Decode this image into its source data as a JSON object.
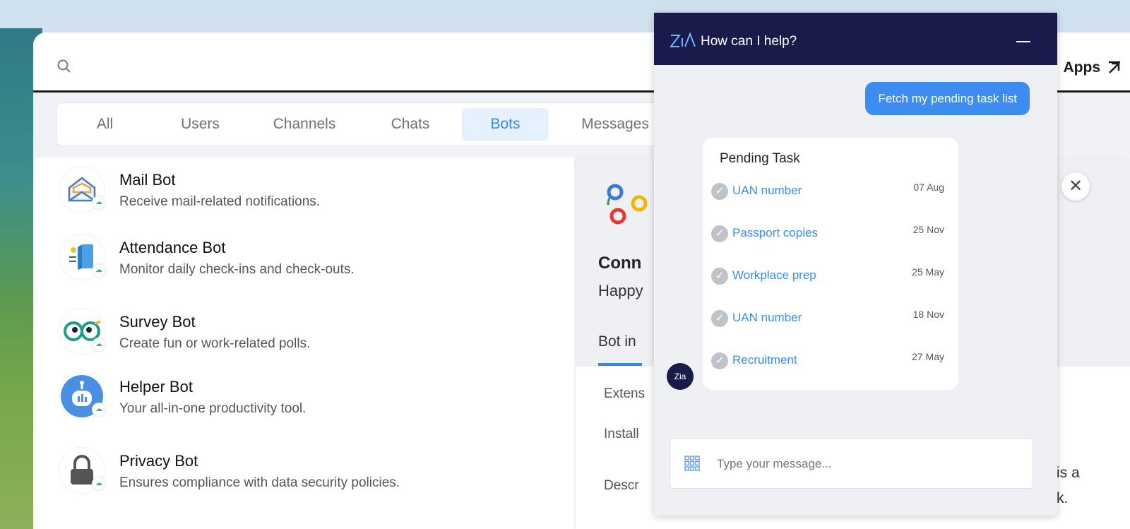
{
  "search": {
    "placeholder": ""
  },
  "header": {
    "apps_label": "Apps"
  },
  "tabs": [
    {
      "label": "All"
    },
    {
      "label": "Users"
    },
    {
      "label": "Channels"
    },
    {
      "label": "Chats"
    },
    {
      "label": "Bots",
      "active": true
    },
    {
      "label": "Messages"
    }
  ],
  "bots": [
    {
      "name": "Mail Bot",
      "description": "Receive mail-related notifications."
    },
    {
      "name": "Attendance Bot",
      "description": "Monitor daily check-ins and check-outs."
    },
    {
      "name": "Survey Bot",
      "description": "Create fun or work-related polls."
    },
    {
      "name": "Helper Bot",
      "description": "Your all-in-one productivity tool."
    },
    {
      "name": "Privacy Bot",
      "description": "Ensures compliance with data security policies."
    }
  ],
  "detail": {
    "title": "Conn",
    "subtitle": "Happy",
    "tab": "Bot in",
    "row1": "Extens",
    "row2": "Install",
    "row3": "Descr",
    "text_right1": "is a",
    "text_right2": "k."
  },
  "zia": {
    "title": "How can I help?",
    "user_message": "Fetch my pending task list",
    "card_title": "Pending Task",
    "tasks": [
      {
        "name": "UAN number",
        "date": "07 Aug"
      },
      {
        "name": "Passport copies",
        "date": "25 Nov"
      },
      {
        "name": "Workplace prep",
        "date": "25 May"
      },
      {
        "name": "UAN number",
        "date": "18 Nov"
      },
      {
        "name": "Recruitment",
        "date": "27 May"
      }
    ],
    "input_placeholder": "Type your message..."
  },
  "colors": {
    "accent": "#3d8cf0",
    "zia_header": "#1b1b4b",
    "active_tab_bg": "#e5f1fd"
  }
}
